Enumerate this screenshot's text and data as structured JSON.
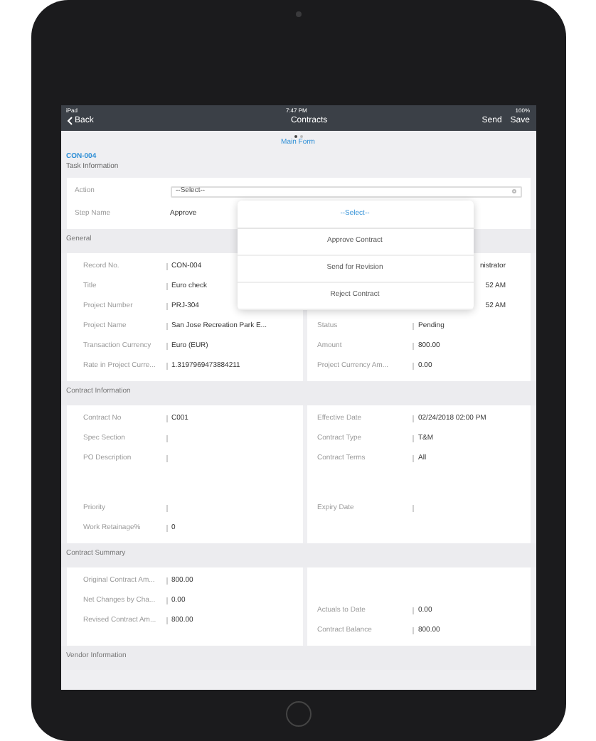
{
  "status_bar": {
    "carrier": "iPad",
    "time": "7:47 PM",
    "battery": "100%"
  },
  "nav": {
    "back": "Back",
    "title": "Contracts",
    "actions": [
      "Send",
      "Save"
    ]
  },
  "pager": {
    "pages": [
      {
        "selected": true
      },
      {
        "selected": false
      }
    ],
    "title": "Main Form"
  },
  "record": {
    "id": "CON-004",
    "subtitle": "Task Information"
  },
  "task": {
    "action_label": "Action",
    "action_value": "--Select--",
    "step_label": "Step Name",
    "step_value": "Approve"
  },
  "popover": {
    "title": "--Select--",
    "options": [
      "Approve Contract",
      "Send for Revision",
      "Reject Contract"
    ]
  },
  "sections": [
    {
      "title": "General",
      "left": [
        {
          "label": "Record No.",
          "value": "CON-004"
        },
        {
          "label": "Title",
          "value": "Euro check"
        },
        {
          "label": "Project Number",
          "value": "PRJ-304"
        },
        {
          "label": "Project Name",
          "value": "San Jose Recreation Park E..."
        },
        {
          "label": "Transaction Currency",
          "value": "Euro (EUR)"
        },
        {
          "label": "Rate in Project Curre...",
          "value": "1.3197969473884211"
        }
      ],
      "right": [
        {
          "kind": "partial",
          "value": "nistrator"
        },
        {
          "kind": "partial",
          "value": "52 AM"
        },
        {
          "kind": "partial",
          "value": "52 AM"
        },
        {
          "label": "Status",
          "value": "Pending"
        },
        {
          "label": "Amount",
          "value": "800.00"
        },
        {
          "label": "Project Currency Am...",
          "value": "0.00"
        }
      ]
    },
    {
      "title": "Contract Information",
      "left": [
        {
          "label": "Contract No",
          "value": "C001"
        },
        {
          "label": "Spec Section"
        },
        {
          "label": "PO Description"
        },
        {
          "kind": "gap"
        },
        {
          "label": "Priority"
        },
        {
          "label": "Work Retainage%",
          "value": "0"
        }
      ],
      "right": [
        {
          "label": "Effective Date",
          "value": "02/24/2018 02:00 PM"
        },
        {
          "label": "Contract Type",
          "value": "T&M"
        },
        {
          "label": "Contract Terms",
          "value": "All"
        },
        {
          "kind": "gap"
        },
        {
          "label": "Expiry Date"
        }
      ]
    },
    {
      "title": "Contract Summary",
      "left": [
        {
          "label": "Original Contract Am...",
          "value": "800.00"
        },
        {
          "label": "Net Changes by Cha...",
          "value": "0.00"
        },
        {
          "label": "Revised Contract Am...",
          "value": "800.00"
        }
      ],
      "right": [
        {
          "kind": "gap"
        },
        {
          "label": "Actuals to Date",
          "value": "0.00"
        },
        {
          "label": "Contract Balance",
          "value": "800.00"
        }
      ]
    },
    {
      "title": "Vendor Information"
    }
  ]
}
